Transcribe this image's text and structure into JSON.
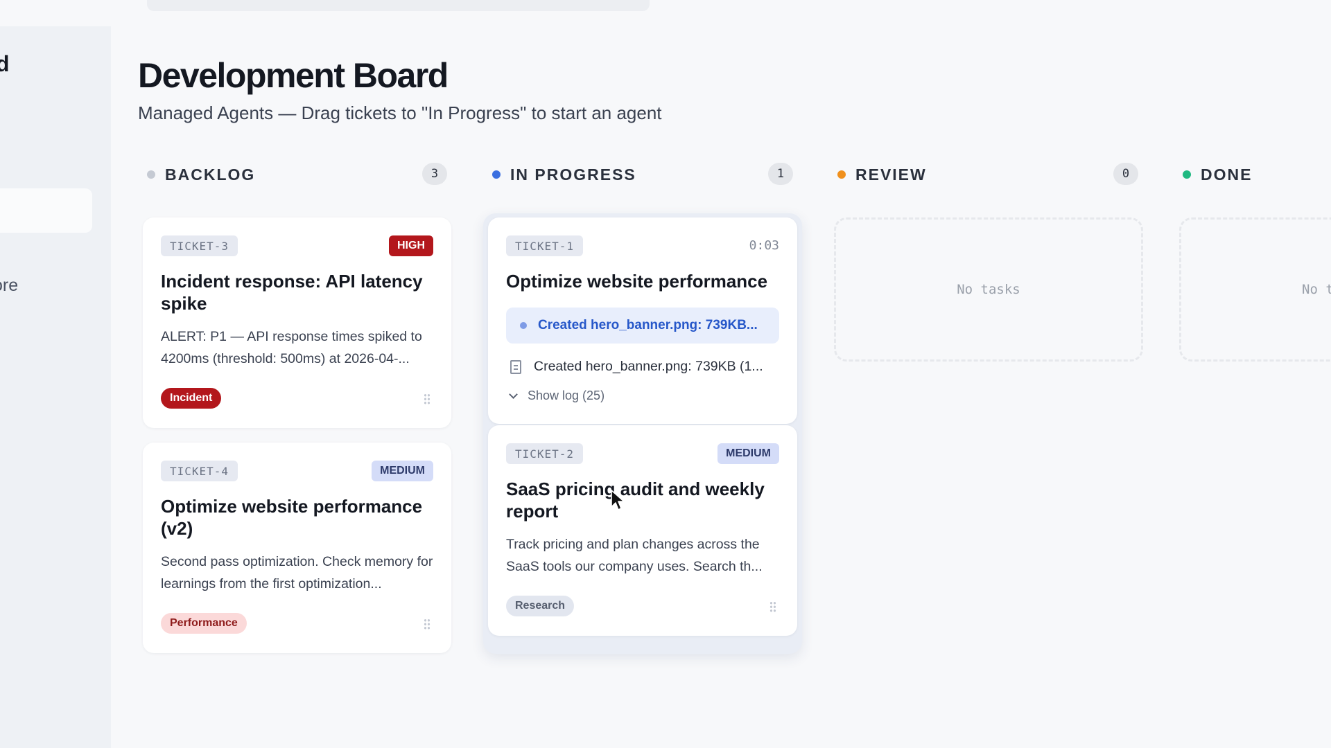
{
  "sidebar": {
    "title_fragment": "d",
    "more_fragment": "ore"
  },
  "header": {
    "title": "Development Board",
    "subtitle": "Managed Agents — Drag tickets to \"In Progress\" to start an agent"
  },
  "columns": [
    {
      "name": "BACKLOG",
      "count": "3",
      "dot_color": "#c5cad3"
    },
    {
      "name": "IN PROGRESS",
      "count": "1",
      "dot_color": "#3b6fe0"
    },
    {
      "name": "REVIEW",
      "count": "0",
      "dot_color": "#f0901c"
    },
    {
      "name": "DONE",
      "dot_color": "#1fb981"
    }
  ],
  "backlog": [
    {
      "id": "TICKET-3",
      "priority": "HIGH",
      "title": "Incident response: API latency spike",
      "description": "ALERT: P1 — API response times spiked to 4200ms (threshold: 500ms) at 2026-04-...",
      "tag": "Incident"
    },
    {
      "id": "TICKET-4",
      "priority": "MEDIUM",
      "title": "Optimize website performance (v2)",
      "description": "Second pass optimization. Check memory for learnings from the first optimization...",
      "tag": "Performance"
    }
  ],
  "in_progress": [
    {
      "id": "TICKET-1",
      "timer": "0:03",
      "title": "Optimize website performance",
      "activity": "Created hero_banner.png: 739KB...",
      "log_line": "Created hero_banner.png: 739KB (1...",
      "show_log": "Show log (25)"
    },
    {
      "id": "TICKET-2",
      "priority": "MEDIUM",
      "title": "SaaS pricing audit and weekly report",
      "description": "Track pricing and plan changes across the SaaS tools our company uses. Search th...",
      "tag": "Research"
    }
  ],
  "review": {
    "empty_text": "No tasks"
  },
  "done": {
    "empty_text": "No t"
  }
}
